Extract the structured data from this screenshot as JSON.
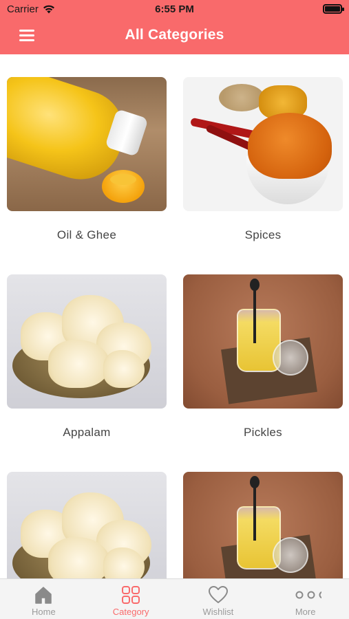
{
  "status_bar": {
    "carrier": "Carrier",
    "time": "6:55 PM"
  },
  "header": {
    "title": "All Categories",
    "menu_icon": "hamburger-menu-icon"
  },
  "categories": [
    {
      "label": "Oil & Ghee",
      "image": "oil-bottle-photo"
    },
    {
      "label": "Spices",
      "image": "spices-photo"
    },
    {
      "label": "Appalam",
      "image": "appalam-bowl-photo"
    },
    {
      "label": "Pickles",
      "image": "ghee-glass-photo"
    },
    {
      "label": "",
      "image": "appalam-bowl-photo"
    },
    {
      "label": "",
      "image": "ghee-glass-photo"
    }
  ],
  "tabbar": {
    "items": [
      {
        "label": "Home",
        "icon": "home-icon",
        "active": false
      },
      {
        "label": "Category",
        "icon": "category-grid-icon",
        "active": true
      },
      {
        "label": "Wishlist",
        "icon": "heart-icon",
        "active": false
      },
      {
        "label": "More",
        "icon": "more-dots-icon",
        "active": false
      }
    ]
  },
  "colors": {
    "brand": "#f96a6b",
    "tab_inactive": "#9a9a9a",
    "label_text": "#444444"
  }
}
